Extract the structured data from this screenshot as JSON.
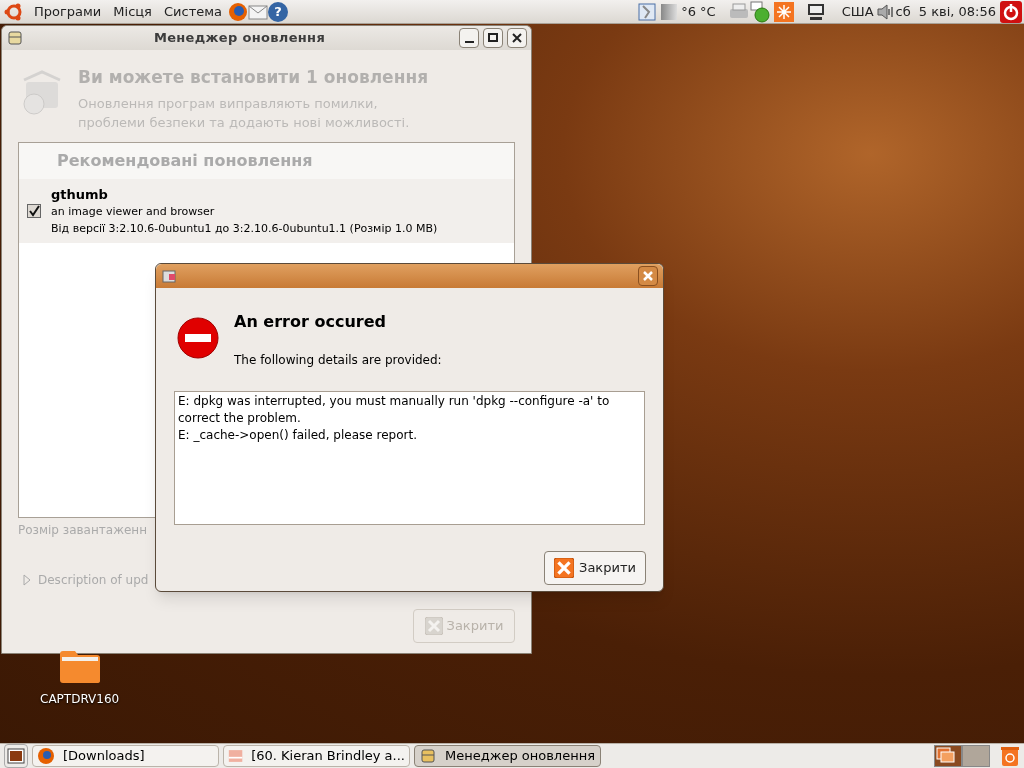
{
  "top_panel": {
    "menus": [
      "Програми",
      "Місця",
      "Система"
    ],
    "help_glyph": "?",
    "weather": "°6 °C",
    "keyboard_layout": "США",
    "day": "сб",
    "date_time": "5 кві, 08:56"
  },
  "update_window": {
    "title": "Менеджер оновлення",
    "heading": "Ви можете встановити 1 оновлення",
    "description": "Оновлення програм виправляють помилки, проблеми безпеки та додають нові можливості.",
    "section": "Рекомендовані поновлення",
    "updates": [
      {
        "name": "gthumb",
        "summary": "an image viewer and browser",
        "version_info": "Від версії 3:2.10.6-0ubuntu1 до 3:2.10.6-0ubuntu1.1 (Розмір 1.0 MB)",
        "checked": true
      }
    ],
    "download_size": "Розмір завантаженн",
    "details_expander": {
      "label": "Description of upd",
      "expanded": false
    },
    "close_button": {
      "label": "Закрити",
      "disabled": true
    }
  },
  "error_dialog": {
    "heading": "An error occured",
    "subheading": "The following details are provided:",
    "details": "E: dpkg was interrupted, you must manually run 'dpkg --configure -a' to correct the problem.\nE: _cache->open() failed, please report.",
    "close_button": {
      "label": "Закрити",
      "disabled": false
    }
  },
  "desktop_icons": [
    {
      "label": "CAPTDRV160"
    }
  ],
  "taskbar": {
    "items": [
      {
        "label": "[Downloads]",
        "kind": "browser",
        "selected": false
      },
      {
        "label": "[60. Kieran Brindley a...",
        "kind": "image",
        "selected": false
      },
      {
        "label": "Менеджер оновлення",
        "kind": "updater",
        "selected": true
      }
    ],
    "workspaces": [
      {
        "selected": true
      },
      {
        "selected": false
      }
    ]
  }
}
